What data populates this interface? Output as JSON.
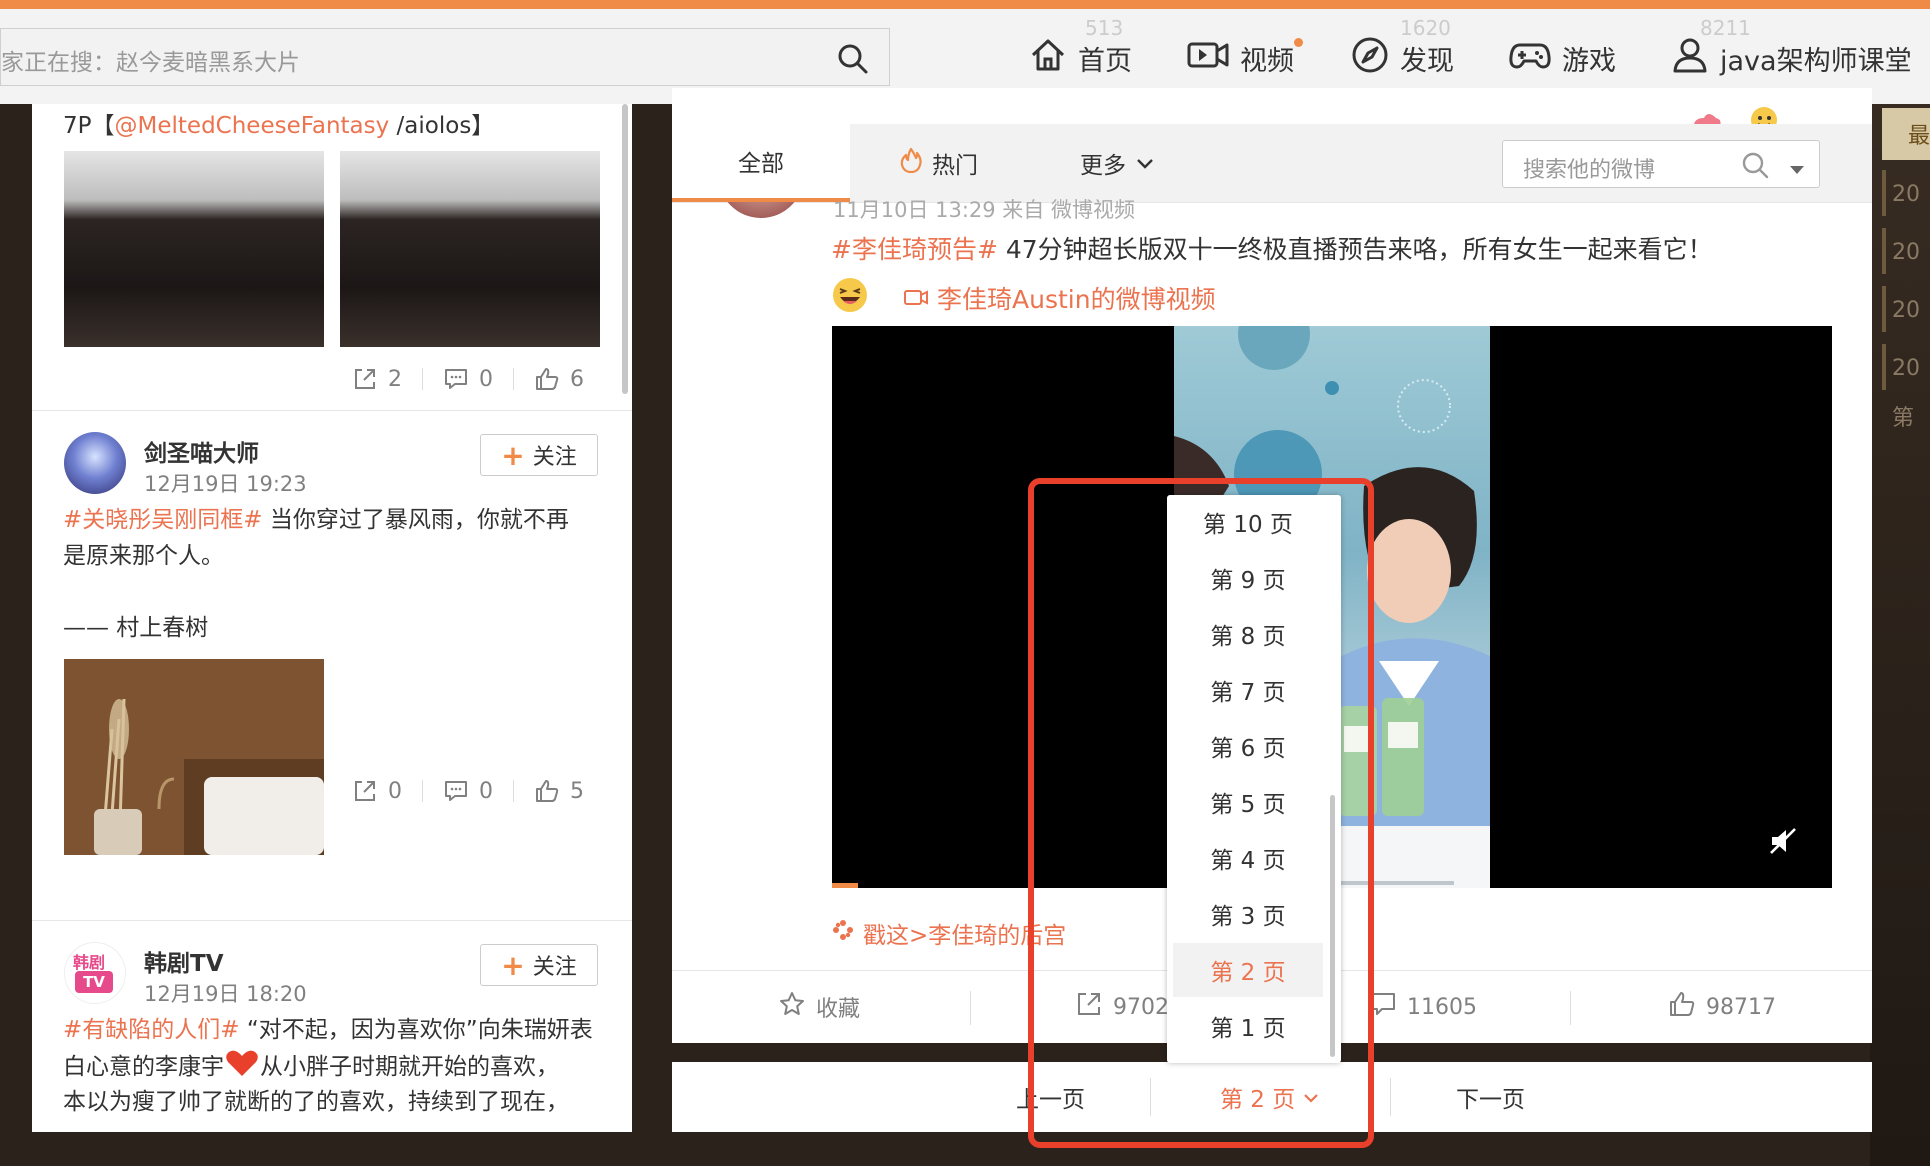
{
  "topbar": {
    "search_placeholder": "家正在搜：赵今麦暗黑系大片",
    "ghost_counts": [
      "513",
      "1620",
      "8211"
    ],
    "nav": [
      {
        "label": "首页",
        "icon": "home-icon"
      },
      {
        "label": "视频",
        "icon": "video-icon"
      },
      {
        "label": "发现",
        "icon": "compass-icon"
      },
      {
        "label": "游戏",
        "icon": "gamepad-icon"
      },
      {
        "label": "java架构师课堂",
        "icon": "user-icon"
      }
    ]
  },
  "left_feed": {
    "post1": {
      "text_prefix": "7P【",
      "mention": "@MeltedCheeseFantasy",
      "text_suffix": " /aiolos】",
      "stats": {
        "repost": "2",
        "comment": "0",
        "like": "6"
      }
    },
    "post2": {
      "user": "剑圣喵大师",
      "time": "12月19日 19:23",
      "follow_label": "关注",
      "topic": "#关晓彤吴刚同框#",
      "text_line1": " 当你穿过了暴风雨，你就不再",
      "text_line2": "是原来那个人。",
      "quote": "—— 村上春树",
      "stats": {
        "repost": "0",
        "comment": "0",
        "like": "5"
      }
    },
    "post3": {
      "user": "韩剧TV",
      "avatar_text_top": "韩剧",
      "avatar_text_bottom": "TV",
      "time": "12月19日 18:20",
      "follow_label": "关注",
      "topic": "#有缺陷的人们#",
      "text_line1": " “对不起，因为喜欢你”向朱瑞妍表",
      "text_line2a": "白心意的李康宇",
      "text_line2b": "从小胖子时期就开始的喜欢，",
      "text_line3": "本以为瘦了帅了就断的了的喜欢，持续到了现在，"
    }
  },
  "main": {
    "tabs": {
      "all": "全部",
      "hot": "热门",
      "more": "更多"
    },
    "search_placeholder": "搜索他的微博",
    "post": {
      "meta": "11月10日 13:29 来自 微博视频",
      "topic": "#李佳琦预告#",
      "text": " 47分钟超长版双十一终极直播预告来咯，所有女生一起来看它！",
      "video_link": "李佳琦Austin的微博视频",
      "hougong": "戳这>李佳琦的后宫",
      "actions": {
        "fav": "收藏",
        "repost": "9702",
        "comment": "11605",
        "like": "98717"
      }
    }
  },
  "pager": {
    "prev": "上一页",
    "current": "第 2 页",
    "next": "下一页"
  },
  "dropdown": {
    "items": [
      "第 10 页",
      "第 9 页",
      "第 8 页",
      "第 7 页",
      "第 6 页",
      "第 5 页",
      "第 4 页",
      "第 3 页",
      "第 2 页",
      "第 1 页"
    ],
    "selected": "第 2 页"
  },
  "right_strip": {
    "tag": "最",
    "years": [
      "20",
      "20",
      "20",
      "20"
    ],
    "bottom": "第"
  },
  "colors": {
    "accent": "#f08a47",
    "link": "#eb7350",
    "highlight": "#e8402a"
  }
}
